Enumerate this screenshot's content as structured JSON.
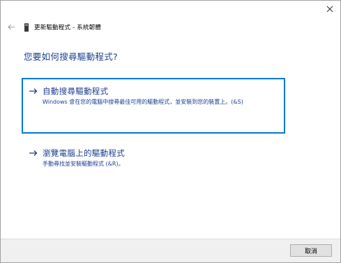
{
  "window": {
    "title": "更新驅動程式 - 系統韌體",
    "close_icon": "close-icon",
    "back_icon": "back-arrow-icon",
    "device_icon": "device-icon"
  },
  "heading": "您要如何搜尋驅動程式?",
  "options": [
    {
      "title": "自動搜尋驅動程式",
      "description": "Windows 會在您的電腦中搜尋最佳可用的驅動程式，並安裝到您的裝置上。(&S)",
      "icon": "arrow-right-icon",
      "selected": true
    },
    {
      "title": "瀏覽電腦上的驅動程式",
      "description": "手動尋找並安裝驅動程式 (&R)。",
      "icon": "arrow-right-icon",
      "selected": false
    }
  ],
  "footer": {
    "cancel_label": "取消"
  },
  "colors": {
    "link_blue": "#1c3d90",
    "focus_border": "#0078d7",
    "footer_bg": "#f0f0f0"
  }
}
